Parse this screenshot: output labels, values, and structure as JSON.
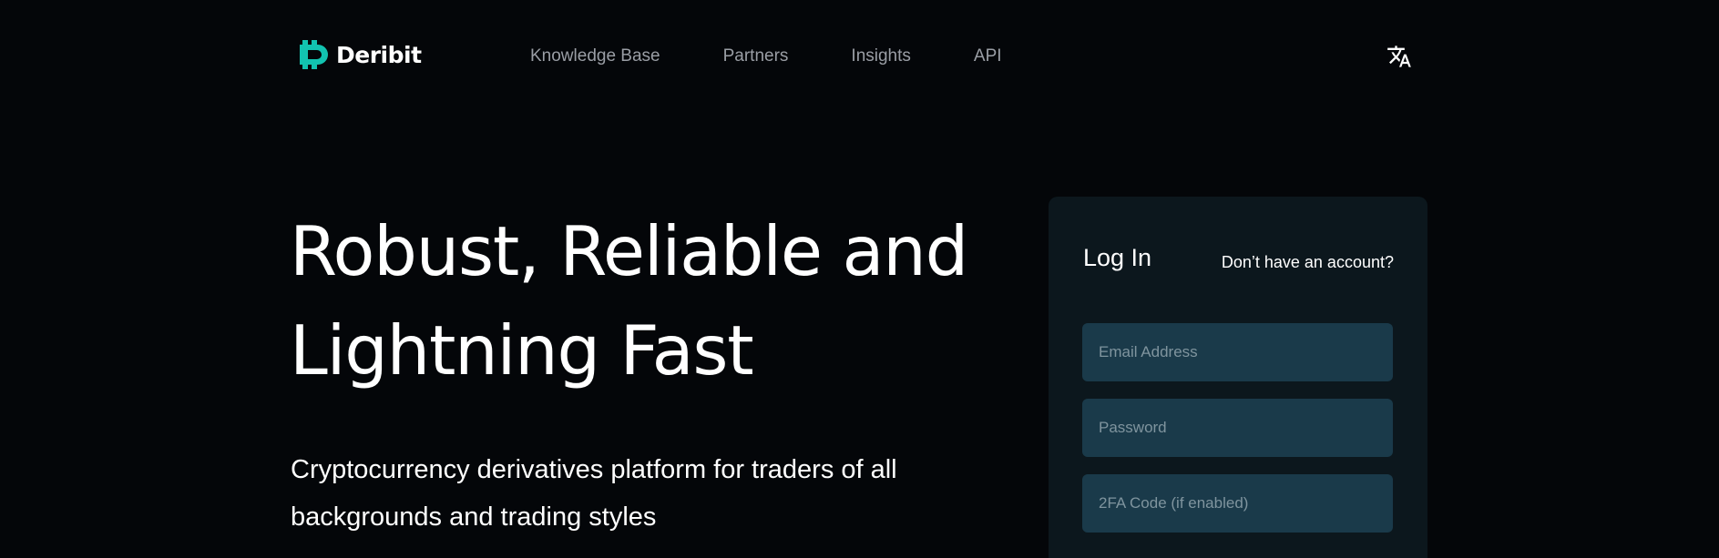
{
  "brand": {
    "name": "Deribit",
    "accent_color": "#12c3b0"
  },
  "nav": {
    "items": [
      {
        "label": "Knowledge Base"
      },
      {
        "label": "Partners"
      },
      {
        "label": "Insights"
      },
      {
        "label": "API"
      }
    ],
    "language_icon": "translate-icon"
  },
  "hero": {
    "title_line1": "Robust, Reliable and",
    "title_line2": "Lightning Fast",
    "subtitle_line1": "Cryptocurrency derivatives platform for traders of all",
    "subtitle_line2": "backgrounds and trading styles"
  },
  "login": {
    "title": "Log In",
    "signup_link": "Don’t have an account?",
    "email_placeholder": "Email Address",
    "password_placeholder": "Password",
    "twofa_placeholder": "2FA Code (if enabled)"
  },
  "colors": {
    "background": "#040609",
    "card": "#0c171d",
    "input": "#1a3a4a",
    "nav_text": "#9a9ea5"
  }
}
